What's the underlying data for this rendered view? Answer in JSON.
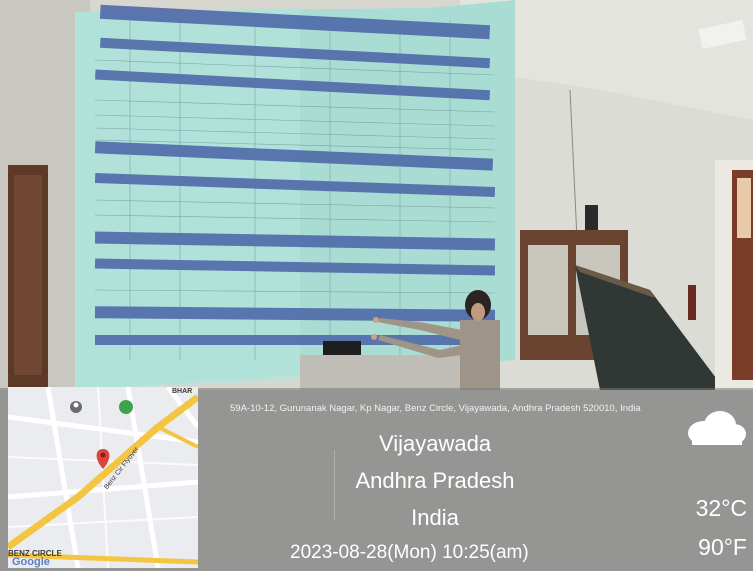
{
  "location": {
    "address": "59A-10-12, Gurunanak Nagar, Kp Nagar, Benz Circle, Vijayawada, Andhra Pradesh 520010, India",
    "city": "Vijayawada",
    "state": "Andhra Pradesh",
    "country": "India"
  },
  "datetime": "2023-08-28(Mon)  10:25(am)",
  "weather": {
    "temp_c": "32°C",
    "temp_f": "90°F",
    "icon": "cloud-icon"
  },
  "map": {
    "label_circle": "BENZ CIRCLE",
    "label_google": "Google",
    "road_label": "Benz Cir Flyover",
    "label_top": "BHAR"
  },
  "colors": {
    "screen": "#9fd8cf",
    "table_header": "#3f5a9e",
    "wall": "#d9d8d1",
    "map_road": "#f4c542",
    "map_pin": "#d9453a",
    "marker": "#3fa34d"
  }
}
